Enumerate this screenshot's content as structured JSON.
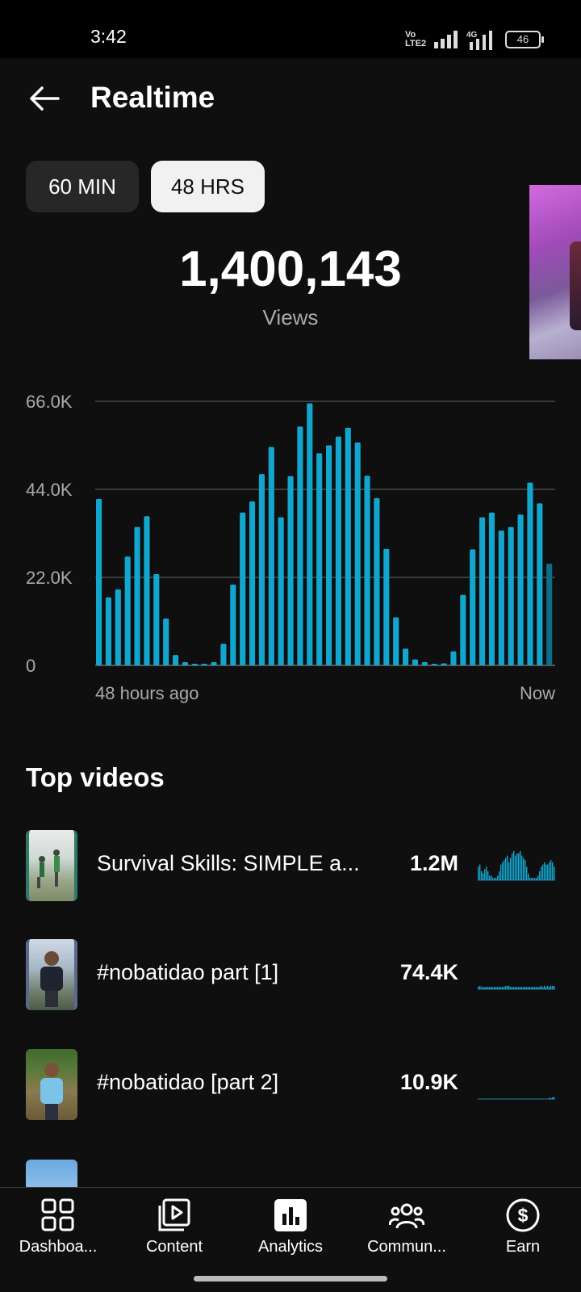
{
  "status_bar": {
    "time": "3:42",
    "network": "4G",
    "volte": "Vo LTE2",
    "battery": "46"
  },
  "header": {
    "title": "Realtime"
  },
  "range_tabs": [
    {
      "label": "60 MIN",
      "selected": false
    },
    {
      "label": "48 HRS",
      "selected": true
    }
  ],
  "summary": {
    "total_views": "1,400,143",
    "metric_label": "Views"
  },
  "chart_data": {
    "type": "bar",
    "ylim": [
      0,
      66000
    ],
    "y_ticks": [
      "0",
      "22.0K",
      "44.0K",
      "66.0K"
    ],
    "x_start_label": "48 hours ago",
    "x_end_label": "Now",
    "grid": true,
    "color": "#12a6cf",
    "values": [
      41600,
      17000,
      19000,
      27200,
      34600,
      37300,
      22800,
      11700,
      2600,
      800,
      400,
      400,
      800,
      5400,
      20200,
      38200,
      41000,
      47800,
      54600,
      37000,
      47300,
      59700,
      65500,
      53000,
      55000,
      57200,
      59400,
      55700,
      47400,
      41800,
      29100,
      12000,
      4200,
      1500,
      800,
      400,
      500,
      3500,
      17600,
      29000,
      37000,
      38200,
      33700,
      34600,
      37700,
      45700,
      40500,
      25400
    ]
  },
  "top_videos": {
    "title": "Top videos",
    "items": [
      {
        "title": "Survival Skills: SIMPLE a...",
        "views": "1.2M",
        "spark": [
          6,
          7,
          4,
          3,
          5,
          6,
          4,
          2,
          2,
          1,
          1,
          1,
          2,
          4,
          7,
          8,
          9,
          10,
          11,
          8,
          10,
          12,
          13,
          11,
          12,
          12,
          13,
          11,
          10,
          9,
          6,
          3,
          1,
          1,
          1,
          1,
          1,
          2,
          4,
          6,
          7,
          8,
          7,
          7,
          8,
          9,
          8,
          6
        ]
      },
      {
        "title": "#nobatidao part [1]",
        "views": "74.4K",
        "spark": [
          1,
          1.5,
          1,
          1,
          1,
          1,
          1,
          1,
          1,
          1,
          1,
          1,
          1,
          1,
          1,
          1,
          1,
          1.5,
          1.5,
          1.5,
          1,
          1,
          1,
          1,
          1,
          1,
          1,
          1,
          1,
          1,
          1,
          1,
          1,
          1,
          1,
          1,
          1,
          1,
          1,
          1.5,
          1,
          1.5,
          1,
          1.5,
          1,
          1.5,
          1.5,
          1.5
        ]
      },
      {
        "title": "#nobatidao [part 2]",
        "views": "10.9K",
        "spark": [
          0,
          0,
          0,
          0,
          0,
          0,
          0,
          0,
          0,
          0,
          0,
          0,
          0,
          0,
          0,
          0,
          0,
          0,
          0,
          0,
          0,
          0,
          0,
          0,
          0,
          0,
          0,
          0,
          0,
          0,
          0,
          0,
          0,
          0,
          0,
          0,
          0,
          0,
          0,
          0,
          0,
          0,
          0,
          0,
          0.5,
          0.5,
          0.8,
          0.8
        ]
      }
    ]
  },
  "bottom_nav": [
    {
      "label": "Dashboa...",
      "icon": "dashboard-icon",
      "active": false
    },
    {
      "label": "Content",
      "icon": "content-icon",
      "active": false
    },
    {
      "label": "Analytics",
      "icon": "analytics-icon",
      "active": true
    },
    {
      "label": "Commun...",
      "icon": "community-icon",
      "active": false
    },
    {
      "label": "Earn",
      "icon": "earn-icon",
      "active": false
    }
  ]
}
